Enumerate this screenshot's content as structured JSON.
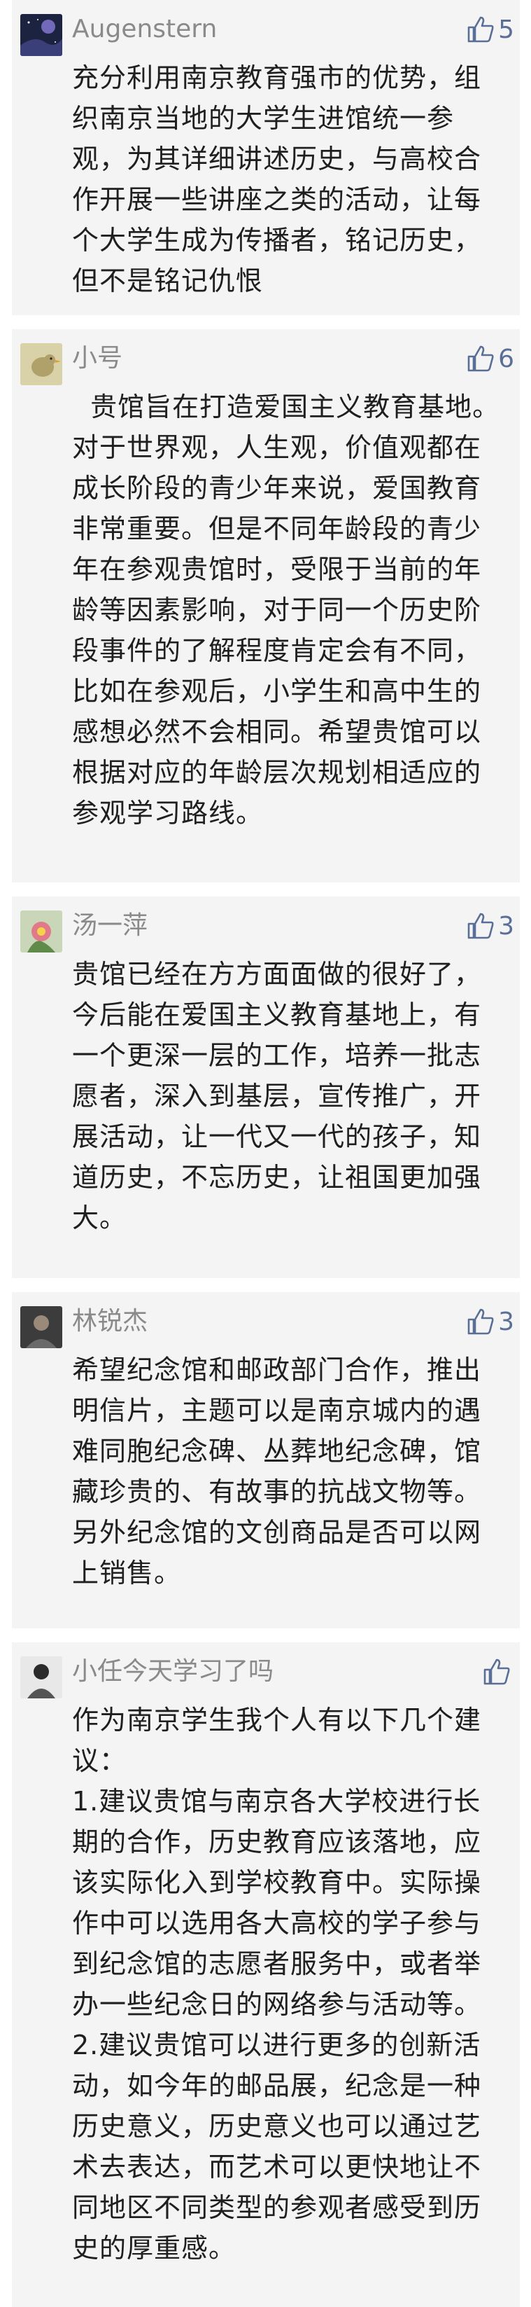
{
  "comments": [
    {
      "username": "Augenstern",
      "likes": "5",
      "avatar": "starry-night-avatar",
      "text": "充分利用南京教育强市的优势，组织南京当地的大学生进馆统一参观，为其详细讲述历史，与高校合作开展一些讲座之类的活动，让每个大学生成为传播者，铭记历史，但不是铭记仇恨"
    },
    {
      "username": "小号",
      "likes": "6",
      "avatar": "bird-avatar",
      "text": "  贵馆旨在打造爱国主义教育基地。对于世界观，人生观，价值观都在成长阶段的青少年来说，爱国教育非常重要。但是不同年龄段的青少年在参观贵馆时，受限于当前的年龄等因素影响，对于同一个历史阶段事件的了解程度肯定会有不同，比如在参观后，小学生和高中生的感想必然不会相同。希望贵馆可以根据对应的年龄层次规划相适应的参观学习路线。"
    },
    {
      "username": "汤一萍",
      "likes": "3",
      "avatar": "flower-avatar",
      "text": "贵馆已经在方方面面做的很好了，今后能在爱国主义教育基地上，有一个更深一层的工作，培养一批志愿者，深入到基层，宣传推广，开展活动，让一代又一代的孩子，知道历史，不忘历史，让祖国更加强大。"
    },
    {
      "username": "林锐杰",
      "likes": "3",
      "avatar": "photo-avatar",
      "text": "希望纪念馆和邮政部门合作，推出明信片，主题可以是南京城内的遇难同胞纪念碑、丛葬地纪念碑，馆藏珍贵的、有故事的抗战文物等。另外纪念馆的文创商品是否可以网上销售。"
    },
    {
      "username": "小任今天学习了吗",
      "likes": "",
      "avatar": "person-avatar",
      "text": "作为南京学生我个人有以下几个建议：\n1.建议贵馆与南京各大学校进行长期的合作，历史教育应该落地，应该实际化入到学校教育中。实际操作中可以选用各大高校的学子参与到纪念馆的志愿者服务中，或者举办一些纪念日的网络参与活动等。\n2.建议贵馆可以进行更多的创新活动，如今年的邮品展，纪念是一种历史意义，历史意义也可以通过艺术去表达，而艺术可以更快地让不同地区不同类型的参观者感受到历史的厚重感。"
    }
  ],
  "colors": {
    "card_background": "#f4f4f4",
    "username": "#8a8a8a",
    "like_blue": "#5a6f96",
    "text": "#1f1f1f"
  }
}
